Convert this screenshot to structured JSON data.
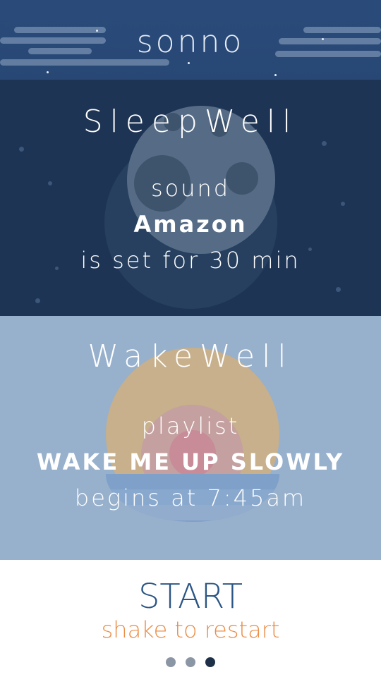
{
  "header": {
    "app_title": "sonno"
  },
  "sleep_well": {
    "title": "SleepWell",
    "line1": "sound",
    "line2": "Amazon",
    "line3": "is set for 30 min"
  },
  "wake_well": {
    "title": "WakeWell",
    "line1": "playlist",
    "line2": "WAKE ME UP SLOWLY",
    "line3": "begins at 7:45am"
  },
  "footer": {
    "start_label": "START",
    "hint": "shake to restart",
    "page_indicator": {
      "total": 3,
      "active": 3
    }
  },
  "colors": {
    "header_bg": "#284775",
    "sleep_bg": "#1e3454",
    "wake_bg": "#97b0cc",
    "start": "#2a5584",
    "hint": "#ea8d47",
    "dot_inactive": "#8b96a5",
    "dot_active": "#1e3048"
  }
}
